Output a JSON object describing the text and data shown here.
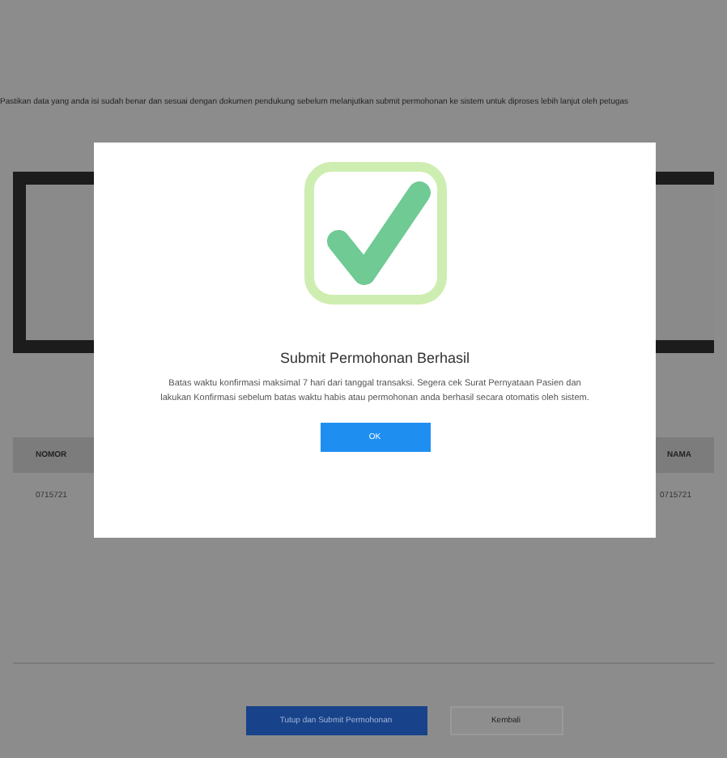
{
  "page": {
    "notice": "Pastikan data yang anda isi sudah benar dan sesuai dengan dokumen pendukung sebelum melanjutkan submit permohonan ke sistem untuk diproses lebih lanjut oleh petugas",
    "table": {
      "columns": [
        "NOMOR",
        "NAMA"
      ],
      "rows": [
        [
          "0715721",
          "0715721"
        ]
      ]
    },
    "buttons": [
      {
        "label": "Tutup dan Submit Permohonan",
        "kind": "primary"
      },
      {
        "label": "Kembali",
        "kind": "secondary"
      }
    ]
  },
  "dialog": {
    "title": "Submit Permohonan Berhasil",
    "message": "Batas waktu konfirmasi maksimal 7 hari dari tanggal transaksi. Segera cek Surat Pernyataan Pasien dan lakukan Konfirmasi sebelum batas waktu habis atau permohonan anda berhasil secara otomatis oleh sistem.",
    "button": "OK"
  }
}
